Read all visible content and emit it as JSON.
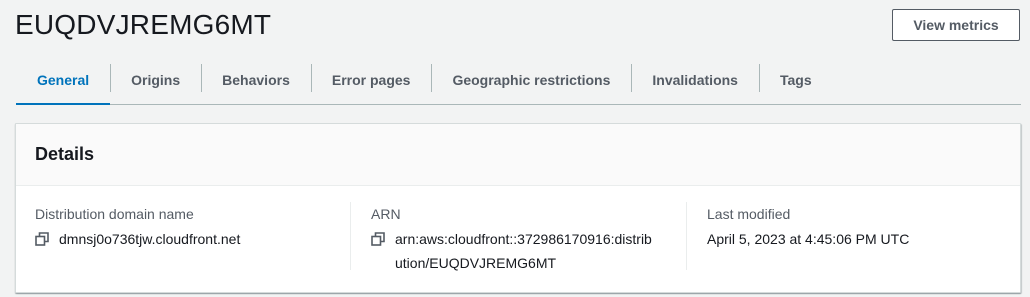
{
  "header": {
    "title": "EUQDVJREMG6MT",
    "view_metrics_label": "View metrics"
  },
  "tabs": [
    {
      "label": "General",
      "active": true
    },
    {
      "label": "Origins",
      "active": false
    },
    {
      "label": "Behaviors",
      "active": false
    },
    {
      "label": "Error pages",
      "active": false
    },
    {
      "label": "Geographic restrictions",
      "active": false
    },
    {
      "label": "Invalidations",
      "active": false
    },
    {
      "label": "Tags",
      "active": false
    }
  ],
  "details": {
    "title": "Details",
    "domain": {
      "label": "Distribution domain name",
      "value": "dmnsj0o736tjw.cloudfront.net",
      "icon": "copy-icon"
    },
    "arn": {
      "label": "ARN",
      "value": "arn:aws:cloudfront::372986170916:distribution/EUQDVJREMG6MT",
      "icon": "copy-icon"
    },
    "last_modified": {
      "label": "Last modified",
      "value": "April 5, 2023 at 4:45:06 PM UTC"
    }
  },
  "colors": {
    "accent": "#0073bb",
    "text": "#16191f",
    "muted": "#545b64",
    "background": "#f2f3f3"
  }
}
